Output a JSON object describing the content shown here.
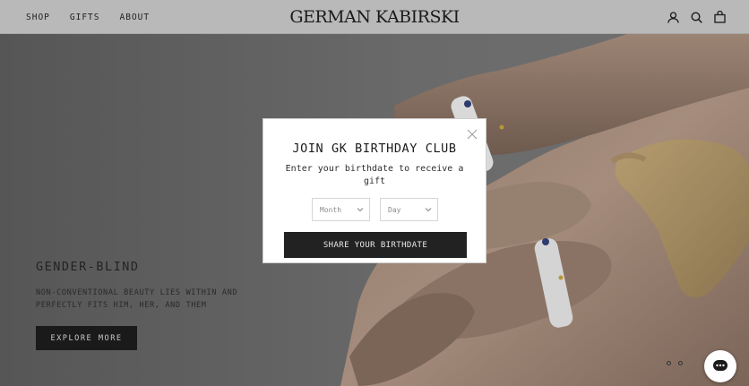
{
  "header": {
    "nav": [
      "SHOP",
      "GIFTS",
      "ABOUT"
    ],
    "logo": "GERMAN KABIRSKI",
    "icons": [
      "account-icon",
      "search-icon",
      "cart-icon"
    ]
  },
  "hero": {
    "title": "GENDER-BLIND",
    "description": "NON-CONVENTIONAL BEAUTY LIES WITHIN AND PERFECTLY FITS HIM, HER, AND THEM",
    "button_label": "EXPLORE MORE"
  },
  "modal": {
    "title": "JOIN GK BIRTHDAY CLUB",
    "subtitle": "Enter your birthdate to receive a gift",
    "month_placeholder": "Month",
    "day_placeholder": "Day",
    "submit_label": "SHARE YOUR BIRTHDATE"
  },
  "colors": {
    "header_bg": "#b9b9b9",
    "button_dark": "#1a1a1a",
    "modal_bg": "#ffffff"
  }
}
